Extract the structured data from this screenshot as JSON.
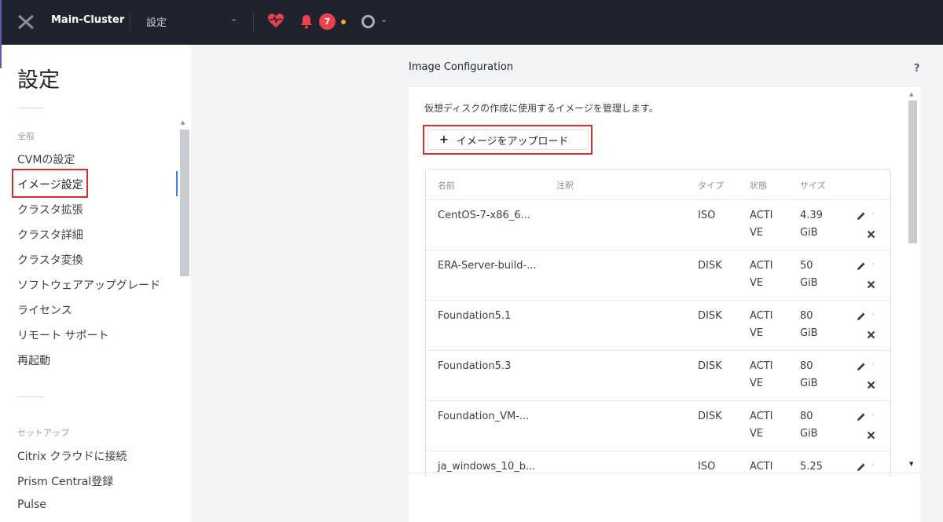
{
  "header": {
    "cluster_name": "Main-Cluster",
    "current_view": "設定",
    "alert_count": "7",
    "colors": {
      "bar": "#1f232d",
      "health": "#e9414e",
      "alert": "#e9414e",
      "warning": "#f5a623"
    }
  },
  "sidebar": {
    "title": "設定",
    "general_label": "全般",
    "general_items": [
      "CVMの設定",
      "イメージ設定",
      "クラスタ拡張",
      "クラスタ詳細",
      "クラスタ変換",
      "ソフトウェアアップグレード",
      "ライセンス",
      "リモート サポート",
      "再起動"
    ],
    "setup_label": "セットアップ",
    "setup_items": [
      "Citrix クラウドに接続",
      "Prism Central登録",
      "Pulse"
    ],
    "active_item": "イメージ設定"
  },
  "main": {
    "section_title": "Image Configuration",
    "help_label": "?",
    "description": "仮想ディスクの作成に使用するイメージを管理します。",
    "upload_label": "イメージをアップロード",
    "columns": {
      "name": "名前",
      "annotation": "注釈",
      "type": "タイプ",
      "state": "状態",
      "size": "サイズ"
    },
    "rows": [
      {
        "name": "CentOS-7-x86_6...",
        "type": "ISO",
        "state": "ACTIVE",
        "size": "4.39 GiB"
      },
      {
        "name": "ERA-Server-build-...",
        "type": "DISK",
        "state": "ACTIVE",
        "size": "50 GiB"
      },
      {
        "name": "Foundation5.1",
        "type": "DISK",
        "state": "ACTIVE",
        "size": "80 GiB"
      },
      {
        "name": "Foundation5.3",
        "type": "DISK",
        "state": "ACTIVE",
        "size": "80 GiB"
      },
      {
        "name": "Foundation_VM-...",
        "type": "DISK",
        "state": "ACTIVE",
        "size": "80 GiB"
      },
      {
        "name": "ja_windows_10_b...",
        "type": "ISO",
        "state": "ACTIVE",
        "size": "5.25"
      }
    ]
  }
}
